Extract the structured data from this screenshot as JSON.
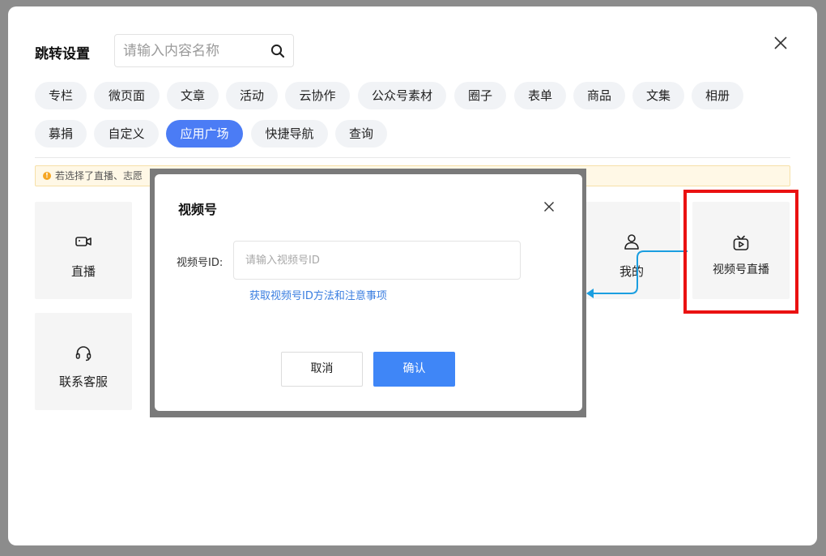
{
  "dialog": {
    "title": "跳转设置",
    "search_placeholder": "请输入内容名称"
  },
  "tabs": [
    {
      "label": "专栏",
      "active": false
    },
    {
      "label": "微页面",
      "active": false
    },
    {
      "label": "文章",
      "active": false
    },
    {
      "label": "活动",
      "active": false
    },
    {
      "label": "云协作",
      "active": false
    },
    {
      "label": "公众号素材",
      "active": false
    },
    {
      "label": "圈子",
      "active": false
    },
    {
      "label": "表单",
      "active": false
    },
    {
      "label": "商品",
      "active": false
    },
    {
      "label": "文集",
      "active": false
    },
    {
      "label": "相册",
      "active": false
    },
    {
      "label": "募捐",
      "active": false
    },
    {
      "label": "自定义",
      "active": false
    },
    {
      "label": "应用广场",
      "active": true
    },
    {
      "label": "快捷导航",
      "active": false
    },
    {
      "label": "查询",
      "active": false
    }
  ],
  "notice": {
    "text": "若选择了直播、志愿"
  },
  "cards": [
    {
      "label": "直播",
      "icon": "video-camera-icon"
    },
    {
      "label": "我的",
      "icon": "user-icon"
    },
    {
      "label": "视频号直播",
      "icon": "tv-play-icon"
    },
    {
      "label": "联系客服",
      "icon": "headset-icon"
    }
  ],
  "modal": {
    "title": "视频号",
    "field_label": "视频号ID:",
    "field_placeholder": "请输入视频号ID",
    "help_link": "获取视频号ID方法和注意事项",
    "cancel_label": "取消",
    "confirm_label": "确认"
  },
  "colors": {
    "primary": "#4b7cf5",
    "confirm": "#3f86f7",
    "link": "#3a7ee0",
    "highlight": "#ea1111",
    "annotation_arrow": "#1a9ee0",
    "overlay": "#8c8c8c"
  }
}
